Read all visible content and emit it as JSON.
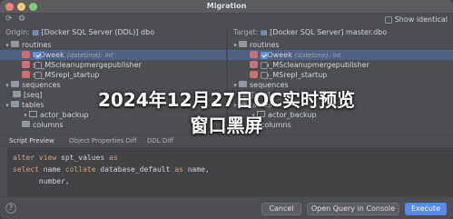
{
  "window": {
    "title": "Migration"
  },
  "toolbar": {
    "show_identical_label": "Show identical",
    "show_identical_checked": false
  },
  "origin": {
    "label": "Origin:",
    "value": "[Docker SQL Server (DDL)] dbo"
  },
  "target": {
    "label": "Target:",
    "value": "[Docker SQL Server] master.dbo"
  },
  "left_tree": [
    {
      "label": "routines",
      "kind": "folder",
      "level": 1
    },
    {
      "label": "ISOweek",
      "meta": "(datetime): int",
      "kind": "function",
      "level": 2,
      "checked": true,
      "selected": true
    },
    {
      "label": "sp_MScleanupmergepublisher",
      "kind": "function",
      "level": 2,
      "checked": false
    },
    {
      "label": "sp_MSrepl_startup",
      "kind": "function",
      "level": 2,
      "checked": false
    },
    {
      "label": "sequences",
      "kind": "folder",
      "level": 1
    },
    {
      "label": "[seq]",
      "kind": "item",
      "level": 2
    },
    {
      "label": "tables",
      "kind": "folder",
      "level": 1
    },
    {
      "label": "actor_backup",
      "kind": "table",
      "level": 2
    },
    {
      "label": "columns",
      "kind": "item",
      "level": 3
    }
  ],
  "right_tree": [
    {
      "label": "routines",
      "kind": "folder",
      "level": 1
    },
    {
      "label": "ISOweek",
      "meta": "(datetime): int",
      "kind": "function",
      "level": 2,
      "checked": true,
      "selected": true
    },
    {
      "label": "sp_MScleanupmergepublisher",
      "kind": "function",
      "level": 2,
      "checked": false
    },
    {
      "label": "sp_MSrepl_startup",
      "kind": "function",
      "level": 2,
      "checked": false
    },
    {
      "label": "sequences",
      "kind": "folder",
      "level": 1
    },
    {
      "label": "[seq]",
      "kind": "item",
      "level": 2
    },
    {
      "label": "tables",
      "kind": "folder",
      "level": 1
    },
    {
      "label": "actor_backup",
      "kind": "table",
      "level": 2
    },
    {
      "label": "columns",
      "kind": "item",
      "level": 3
    }
  ],
  "tabs": [
    "Script Preview",
    "Object Properties Diff",
    "DDL Diff"
  ],
  "code": [
    [
      [
        "kw",
        "alter "
      ],
      [
        "kw",
        "view "
      ],
      [
        "id",
        "spt_values "
      ],
      [
        "kw",
        "as"
      ]
    ],
    [
      [
        "kw",
        "select "
      ],
      [
        "id",
        "name "
      ],
      [
        "kw",
        "collate "
      ],
      [
        "id",
        "database_default "
      ],
      [
        "kw",
        "as "
      ],
      [
        "id",
        "name,"
      ]
    ],
    [
      [
        "id",
        "      number,"
      ]
    ]
  ],
  "buttons": {
    "help": "?",
    "cancel": "Cancel",
    "open_query": "Open Query in Console",
    "execute": "Execute"
  },
  "headline": {
    "line1": "2024年12月27日OC实时预览",
    "line2": "窗口黑屏"
  },
  "colors": {
    "accent": "#3574f0",
    "selection": "#2e436e",
    "keyword": "#cf8e6d"
  }
}
